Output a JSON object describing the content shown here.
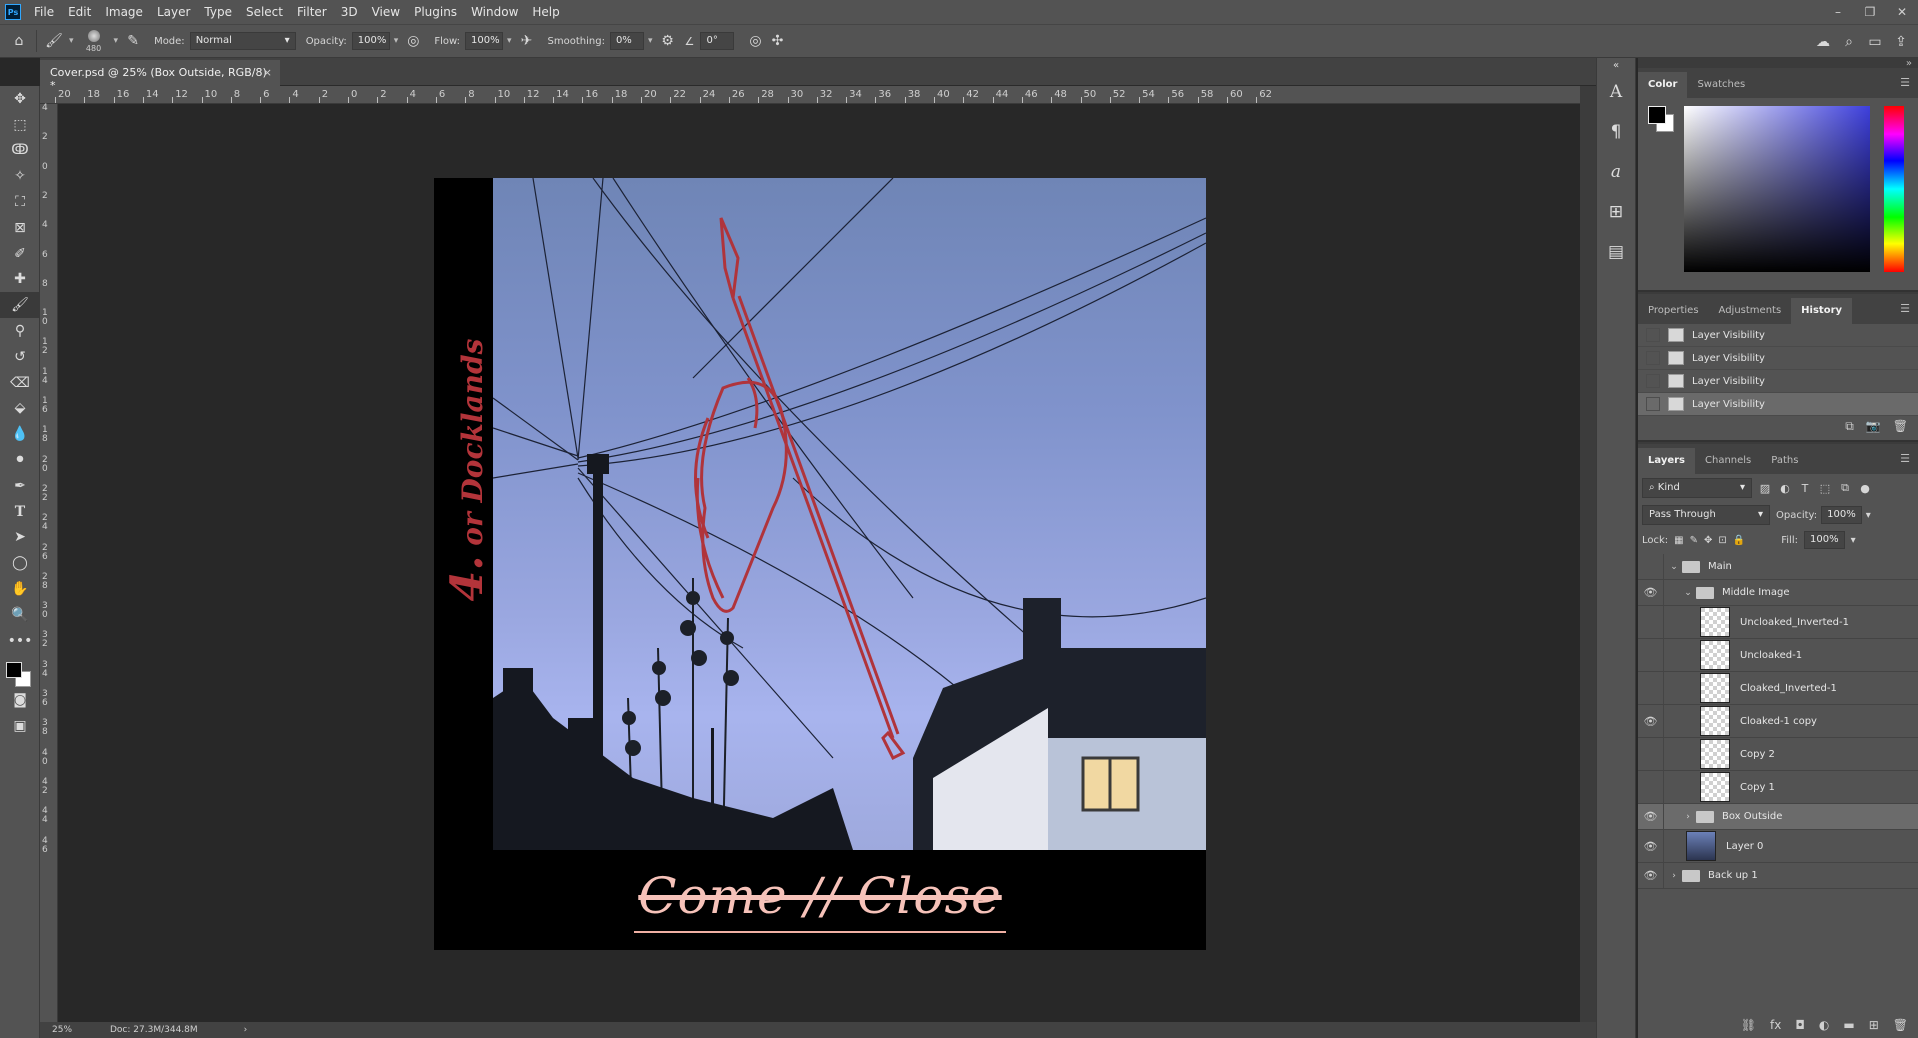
{
  "app": {
    "logo_text": "Ps"
  },
  "menu": [
    "File",
    "Edit",
    "Image",
    "Layer",
    "Type",
    "Select",
    "Filter",
    "3D",
    "View",
    "Plugins",
    "Window",
    "Help"
  ],
  "window_controls": [
    "–",
    "❐",
    "✕"
  ],
  "options_bar": {
    "brush_size": "480",
    "mode_label": "Mode:",
    "mode_value": "Normal",
    "opacity_label": "Opacity:",
    "opacity_value": "100%",
    "flow_label": "Flow:",
    "flow_value": "100%",
    "smoothing_label": "Smoothing:",
    "smoothing_value": "0%",
    "angle_value": "0°"
  },
  "document_tab": {
    "title": "Cover.psd @ 25% (Box Outside, RGB/8) *",
    "close": "×"
  },
  "ruler_top": [
    "20",
    "18",
    "16",
    "14",
    "12",
    "10",
    "8",
    "6",
    "4",
    "2",
    "0",
    "2",
    "4",
    "6",
    "8",
    "10",
    "12",
    "14",
    "16",
    "18",
    "20",
    "22",
    "24",
    "26",
    "28",
    "30",
    "32",
    "34",
    "36",
    "38",
    "40",
    "42",
    "44",
    "46",
    "48",
    "50",
    "52",
    "54",
    "56",
    "58",
    "60",
    "62"
  ],
  "ruler_left": [
    "4",
    "2",
    "0",
    "2",
    "4",
    "6",
    "8",
    "1 0",
    "1 2",
    "1 4",
    "1 6",
    "1 8",
    "2 0",
    "2 2",
    "2 4",
    "2 6",
    "2 8",
    "3 0",
    "3 2",
    "3 4",
    "3 6",
    "3 8",
    "4 0",
    "4 2",
    "4 4",
    "4 6"
  ],
  "canvas": {
    "spine_number": "4.",
    "spine_text": " or Docklands",
    "cover_title": "Come // Close",
    "accent_red": "#b3343a",
    "title_color": "#f6c2b9"
  },
  "status": {
    "zoom": "25%",
    "doc": "Doc: 27.3M/344.8M",
    "arrow": "›"
  },
  "color_panel": {
    "tabs": [
      "Color",
      "Swatches"
    ]
  },
  "history_panel": {
    "tabs": [
      "Properties",
      "Adjustments",
      "History"
    ],
    "items": [
      "Layer Visibility",
      "Layer Visibility",
      "Layer Visibility",
      "Layer Visibility"
    ]
  },
  "layers_panel": {
    "tabs": [
      "Layers",
      "Channels",
      "Paths"
    ],
    "kind_label": "Kind",
    "blend_mode": "Pass Through",
    "opacity_label": "Opacity:",
    "opacity_value": "100%",
    "lock_label": "Lock:",
    "fill_label": "Fill:",
    "fill_value": "100%",
    "layers": [
      {
        "name": "Main",
        "type": "group",
        "visible": false,
        "indent": 1,
        "expanded": true
      },
      {
        "name": "Middle Image",
        "type": "group",
        "visible": true,
        "indent": 2,
        "expanded": true
      },
      {
        "name": "Uncloaked_Inverted-1",
        "type": "smart",
        "visible": false,
        "indent": 3
      },
      {
        "name": "Uncloaked-1",
        "type": "smart",
        "visible": false,
        "indent": 3
      },
      {
        "name": "Cloaked_Inverted-1",
        "type": "pixel",
        "visible": false,
        "indent": 3
      },
      {
        "name": "Cloaked-1 copy",
        "type": "pixel",
        "visible": true,
        "indent": 3
      },
      {
        "name": "Copy 2",
        "type": "pixel",
        "visible": false,
        "indent": 3
      },
      {
        "name": "Copy 1",
        "type": "pixel",
        "visible": false,
        "indent": 3
      },
      {
        "name": "Box Outside",
        "type": "group",
        "visible": true,
        "indent": 2,
        "expanded": false,
        "selected": true
      },
      {
        "name": "Layer 0",
        "type": "photo",
        "visible": true,
        "indent": 2
      },
      {
        "name": "Back up 1",
        "type": "group",
        "visible": true,
        "indent": 1,
        "expanded": false
      }
    ]
  }
}
